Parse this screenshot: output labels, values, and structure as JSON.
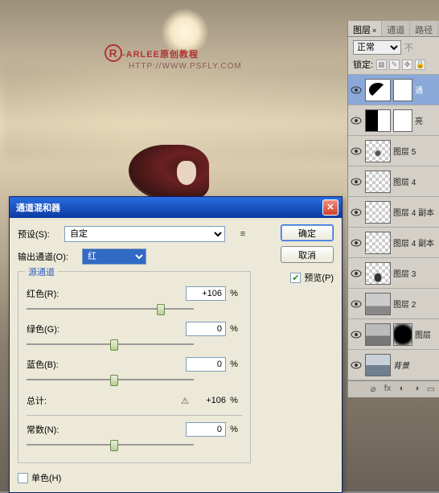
{
  "watermark": {
    "r": "R",
    "title": "-ARLEE原创教程",
    "url": "HTTP://WWW.PSFLY.COM"
  },
  "dialog": {
    "title": "通道混和器",
    "preset_label": "预设(S):",
    "preset_value": "自定",
    "output_label": "输出通道(O):",
    "output_value": "红",
    "group_title": "源通道",
    "red_label": "红色(R):",
    "green_label": "绿色(G):",
    "blue_label": "蓝色(B):",
    "red_value": "+106",
    "green_value": "0",
    "blue_value": "0",
    "pct": "%",
    "total_label": "总计:",
    "total_warn": "⚠",
    "total_value": "+106",
    "const_label": "常数(N):",
    "const_value": "0",
    "mono_label": "单色(H)",
    "ok": "确定",
    "cancel": "取消",
    "preview_label": "预览(P)"
  },
  "panel": {
    "tabs": {
      "layers": "图层",
      "channels": "通道",
      "paths": "路径"
    },
    "blend": "正常",
    "opacity_lbl": "不",
    "lock_label": "锁定:",
    "layers": [
      {
        "name": "通"
      },
      {
        "name": "亮"
      },
      {
        "name": "图层 5"
      },
      {
        "name": "图层 4"
      },
      {
        "name": "图层 4 副本"
      },
      {
        "name": "图层 4 副本"
      },
      {
        "name": "图层 3"
      },
      {
        "name": "图层 2"
      },
      {
        "name": "图层"
      },
      {
        "name": "背景"
      }
    ]
  },
  "chart_data": {
    "type": "table",
    "title": "Channel Mixer — Output: Red",
    "rows": [
      {
        "channel": "红色",
        "value_pct": 106
      },
      {
        "channel": "绿色",
        "value_pct": 0
      },
      {
        "channel": "蓝色",
        "value_pct": 0
      },
      {
        "channel": "常数",
        "value_pct": 0
      }
    ],
    "total_pct": 106
  }
}
